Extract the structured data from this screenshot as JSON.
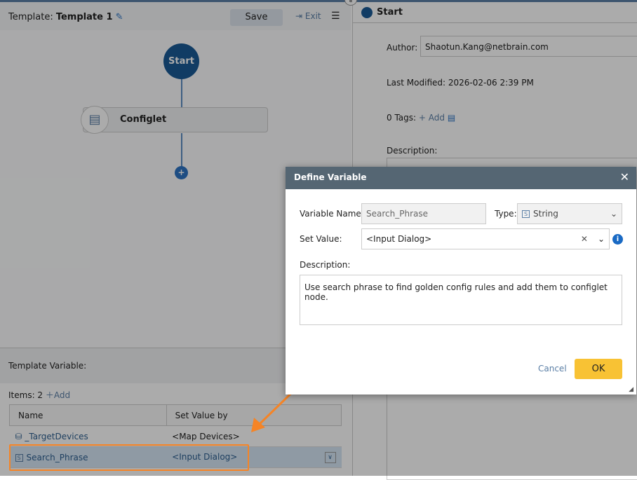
{
  "header": {
    "template_label": "Template:",
    "template_name": "Template 1",
    "save": "Save",
    "exit": "Exit"
  },
  "flow": {
    "start": "Start",
    "configlet": "Configlet"
  },
  "variables": {
    "title": "Template Variable:",
    "items_label": "Items: 2",
    "add": "Add",
    "columns": [
      "Name",
      "Set Value by"
    ],
    "rows": [
      {
        "name": "_TargetDevices",
        "value": "<Map Devices>"
      },
      {
        "name": "Search_Phrase",
        "value": "<Input Dialog>"
      }
    ]
  },
  "panel": {
    "title": "Start",
    "author_label": "Author:",
    "author": "Shaotun.Kang@netbrain.com",
    "modified_label": "Last Modified:",
    "modified": "2026-02-06 2:39 PM",
    "tags": "0 Tags:",
    "add_tag": "+ Add",
    "desc_label": "Description:"
  },
  "dialog": {
    "title": "Define Variable",
    "name_label": "Variable Name:",
    "name": "Search_Phrase",
    "type_label": "Type:",
    "type": "String",
    "set_label": "Set Value:",
    "set_value": "<Input Dialog>",
    "desc_label": "Description:",
    "description": "Use search phrase to find golden config rules and add them to configlet node.",
    "cancel": "Cancel",
    "ok": "OK"
  }
}
